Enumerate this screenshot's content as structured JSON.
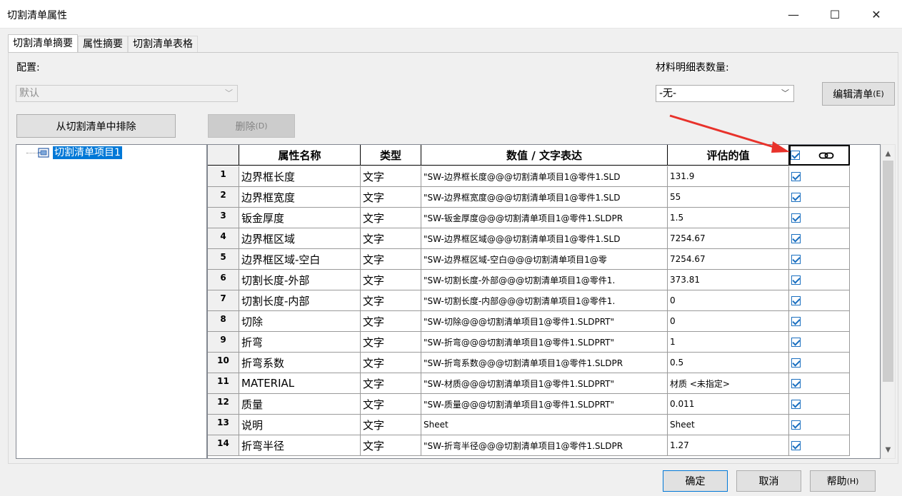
{
  "window": {
    "title": "切割清单属性",
    "minimize_glyph": "—",
    "maximize_glyph": "☐",
    "close_glyph": "✕"
  },
  "tabs": [
    {
      "label": "切割清单摘要",
      "active": true
    },
    {
      "label": "属性摘要",
      "active": false
    },
    {
      "label": "切割清单表格",
      "active": false
    }
  ],
  "config": {
    "label": "配置:",
    "value": "默认",
    "disabled": true
  },
  "bom": {
    "label": "材料明细表数量:",
    "value": "-无-"
  },
  "buttons": {
    "edit_list": "编辑清单",
    "edit_list_hotkey": "(E)",
    "exclude": "从切割清单中排除",
    "delete": "删除",
    "delete_hotkey": "(D)",
    "ok": "确定",
    "cancel": "取消",
    "help": "帮助",
    "help_hotkey": "(H)"
  },
  "tree": {
    "item_label": "切割清单项目1",
    "item_icon": "cut-list-item-icon"
  },
  "grid": {
    "columns": [
      "属性名称",
      "类型",
      "数值 / 文字表达",
      "评估的值"
    ],
    "header_link_icon": "link-icon",
    "rows": [
      {
        "num": "1",
        "name": "边界框长度",
        "type": "文字",
        "expr": "\"SW-边界框长度@@@切割清单项目1@零件1.SLD",
        "value": "131.9",
        "checked": true
      },
      {
        "num": "2",
        "name": "边界框宽度",
        "type": "文字",
        "expr": "\"SW-边界框宽度@@@切割清单项目1@零件1.SLD",
        "value": "55",
        "checked": true
      },
      {
        "num": "3",
        "name": "钣金厚度",
        "type": "文字",
        "expr": "\"SW-钣金厚度@@@切割清单项目1@零件1.SLDPR",
        "value": "1.5",
        "checked": true
      },
      {
        "num": "4",
        "name": "边界框区域",
        "type": "文字",
        "expr": "\"SW-边界框区域@@@切割清单项目1@零件1.SLD",
        "value": "7254.67",
        "checked": true
      },
      {
        "num": "5",
        "name": "边界框区域-空白",
        "type": "文字",
        "expr": "\"SW-边界框区域-空白@@@切割清单项目1@零",
        "value": "7254.67",
        "checked": true
      },
      {
        "num": "6",
        "name": "切割长度-外部",
        "type": "文字",
        "expr": "\"SW-切割长度-外部@@@切割清单项目1@零件1.",
        "value": "373.81",
        "checked": true
      },
      {
        "num": "7",
        "name": "切割长度-内部",
        "type": "文字",
        "expr": "\"SW-切割长度-内部@@@切割清单项目1@零件1.",
        "value": "0",
        "checked": true
      },
      {
        "num": "8",
        "name": "切除",
        "type": "文字",
        "expr": "\"SW-切除@@@切割清单项目1@零件1.SLDPRT\"",
        "value": "0",
        "checked": true
      },
      {
        "num": "9",
        "name": "折弯",
        "type": "文字",
        "expr": "\"SW-折弯@@@切割清单项目1@零件1.SLDPRT\"",
        "value": "1",
        "checked": true
      },
      {
        "num": "10",
        "name": "折弯系数",
        "type": "文字",
        "expr": "\"SW-折弯系数@@@切割清单项目1@零件1.SLDPR",
        "value": "0.5",
        "checked": true
      },
      {
        "num": "11",
        "name": "MATERIAL",
        "type": "文字",
        "expr": "\"SW-材质@@@切割清单项目1@零件1.SLDPRT\"",
        "value": "材质 <未指定>",
        "checked": true
      },
      {
        "num": "12",
        "name": "质量",
        "type": "文字",
        "expr": "\"SW-质量@@@切割清单项目1@零件1.SLDPRT\"",
        "value": "0.011",
        "checked": true
      },
      {
        "num": "13",
        "name": "说明",
        "type": "文字",
        "expr": "Sheet",
        "value": "Sheet",
        "checked": true
      },
      {
        "num": "14",
        "name": "折弯半径",
        "type": "文字",
        "expr": "\"SW-折弯半径@@@切割清单项目1@零件1.SLDPR",
        "value": "1.27",
        "checked": true
      }
    ]
  },
  "colors": {
    "selection": "#0078d7",
    "annotation_arrow": "#e8322b"
  }
}
